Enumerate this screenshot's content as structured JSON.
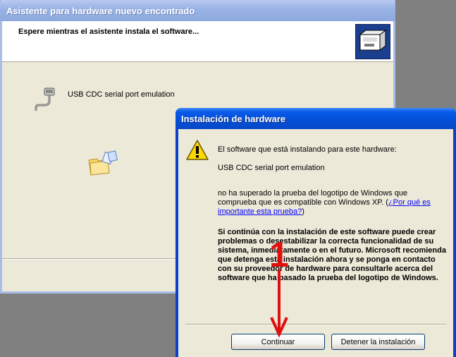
{
  "wizard": {
    "title": "Asistente para hardware nuevo encontrado",
    "heading": "Espere mientras el asistente instala el software...",
    "device_name": "USB CDC serial port emulation"
  },
  "dialog": {
    "title": "Instalación de hardware",
    "intro": "El software que está instalando para este hardware:",
    "device_name": "USB CDC serial port emulation",
    "logo_text_before_link": "no ha superado la prueba del logotipo de Windows que comprueba que es compatible con Windows XP. (",
    "logo_link": "¿Por qué es importante esta prueba?",
    "logo_text_after_link": ")",
    "warning_bold": "Si continúa con la instalación de este software puede crear problemas o desestabilizar la correcta funcionalidad de su sistema, inmediatamente o en el futuro. Microsoft recomienda que detenga esta instalación ahora y se ponga en contacto con su proveedor de hardware para consultarle acerca del software que ha pasado la prueba del logotipo de Windows.",
    "continue_label": "Continuar",
    "stop_label": "Detener la instalación"
  },
  "annotation": {
    "number": "1",
    "color": "#e01010"
  },
  "colors": {
    "dialog_title_bar": "#0450d8",
    "wizard_title_bar_inactive": "#98b2e4",
    "window_face": "#ece9d8"
  }
}
